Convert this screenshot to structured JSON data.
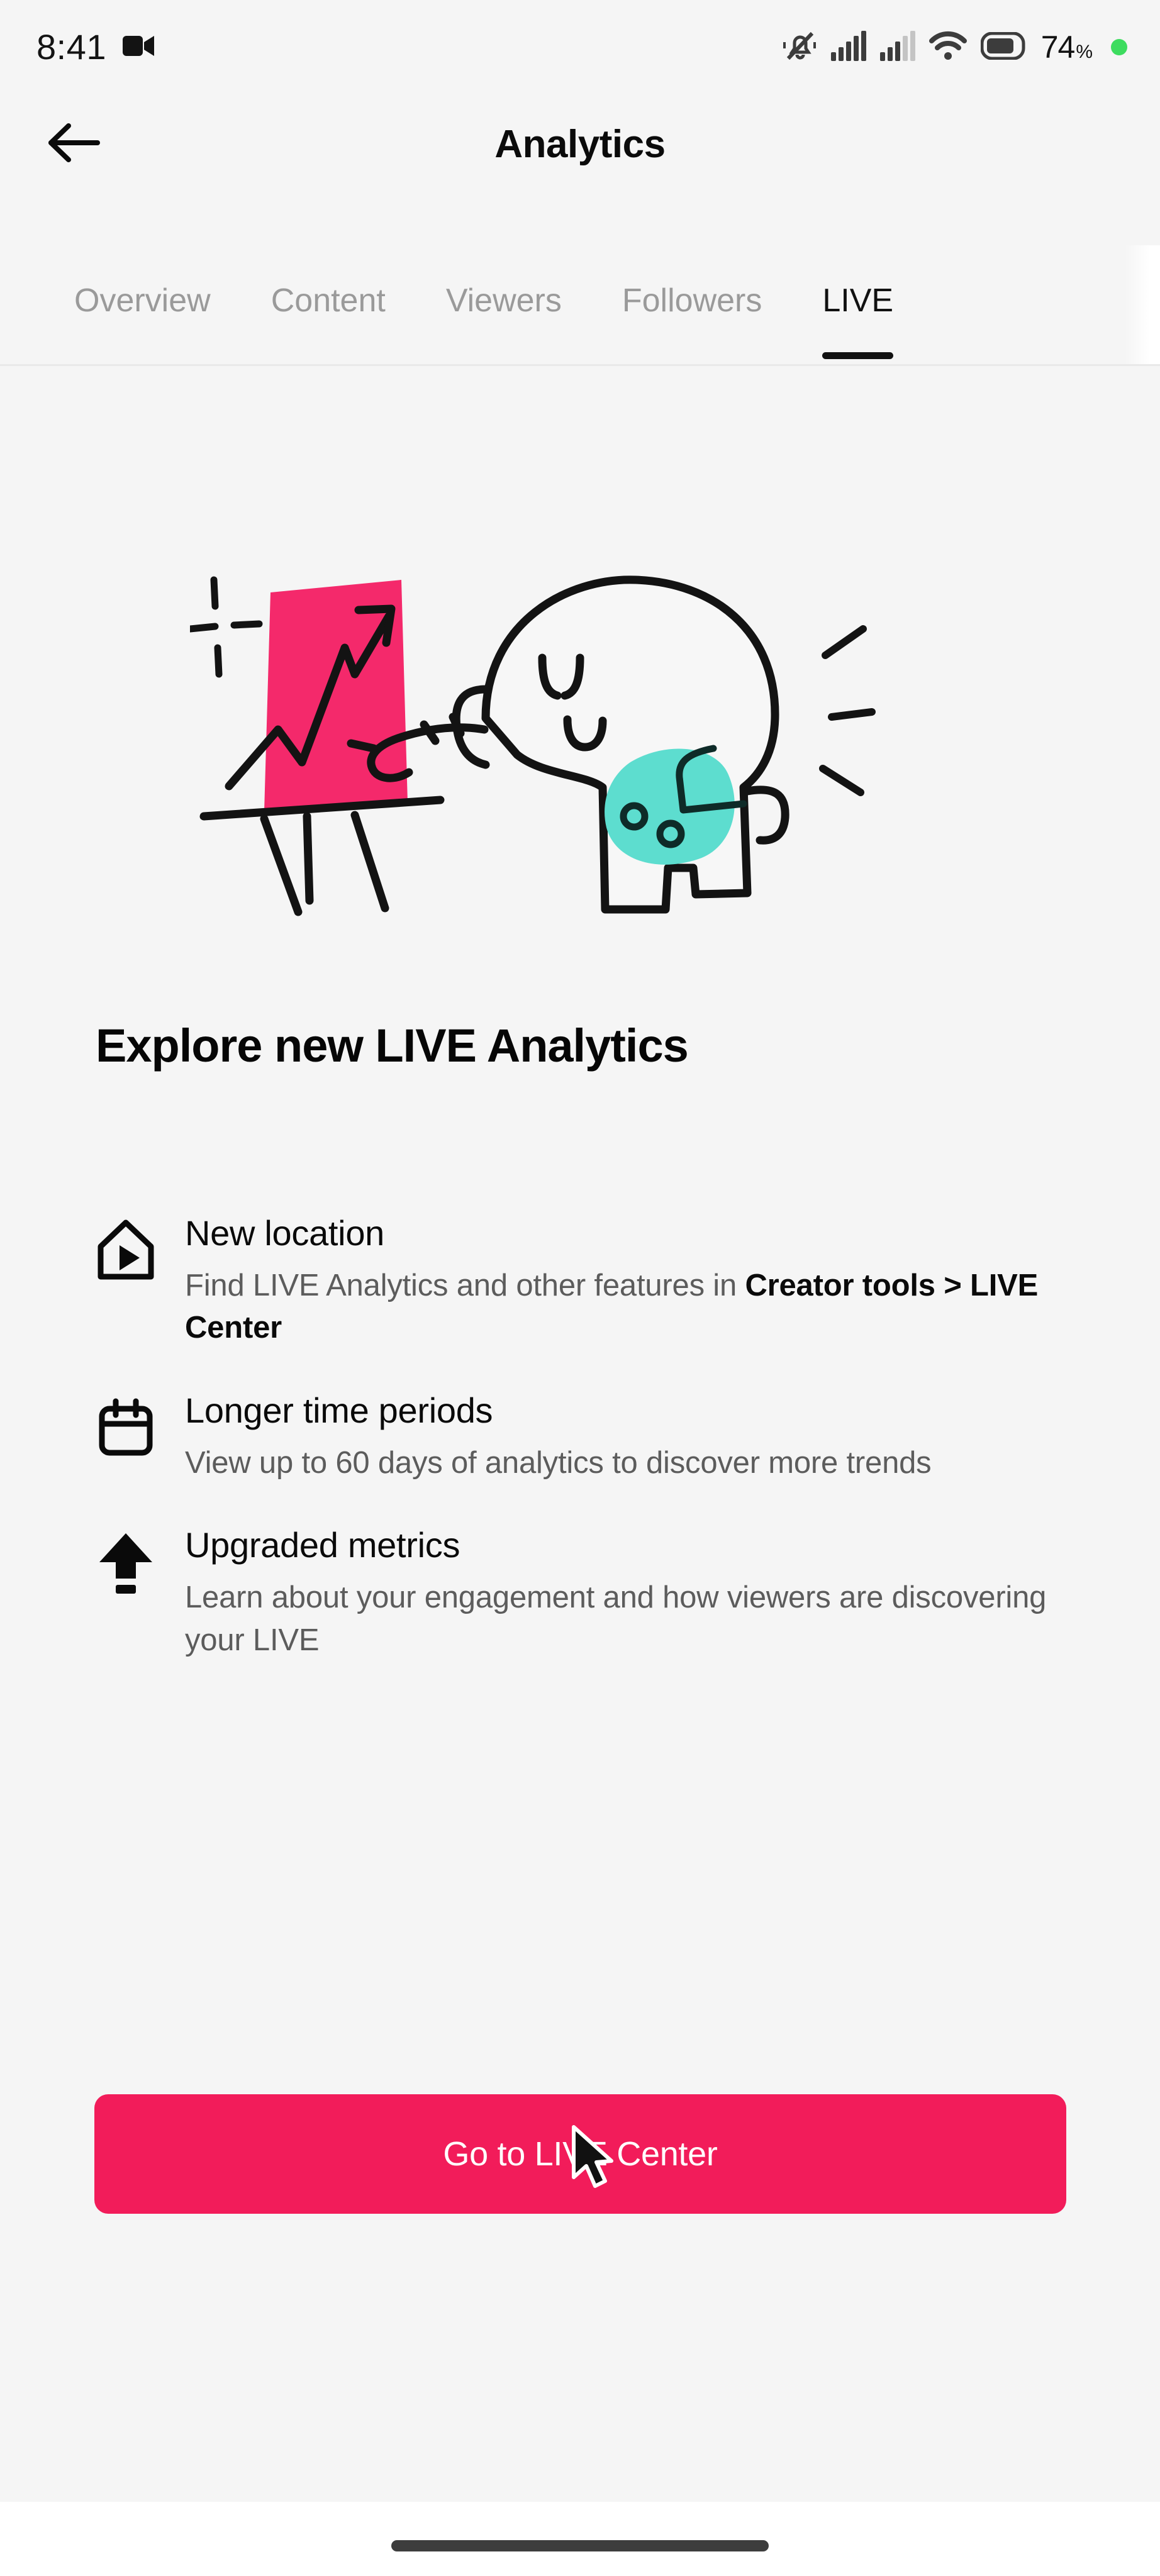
{
  "statusbar": {
    "time": "8:41",
    "battery_percent": "74",
    "percent_symbol": "%",
    "icons": [
      "video-camera-icon",
      "bell-silent-icon",
      "signal-bars-icon",
      "signal-bars-secondary-icon",
      "wifi-icon",
      "battery-icon",
      "recording-indicator-dot"
    ],
    "recording_dot_color": "#3ddc5f"
  },
  "header": {
    "title": "Analytics",
    "back_icon": "back-arrow-icon"
  },
  "tabs": [
    {
      "label": "Overview",
      "active": false
    },
    {
      "label": "Content",
      "active": false
    },
    {
      "label": "Viewers",
      "active": false
    },
    {
      "label": "Followers",
      "active": false
    },
    {
      "label": "LIVE",
      "active": true
    }
  ],
  "illustration": {
    "name": "elephant-presenting-chart-illustration",
    "board_color": "#f4296b",
    "blob_color": "#5dddcf",
    "line_color": "#131313"
  },
  "main": {
    "headline": "Explore new LIVE Analytics",
    "features": [
      {
        "icon": "live-home-play-icon",
        "title": "New location",
        "desc_plain": "Find LIVE Analytics and other features in",
        "desc_strong": "Creator tools > LIVE Center"
      },
      {
        "icon": "calendar-icon",
        "title": "Longer time periods",
        "desc_plain": "View up to 60 days of analytics to discover more trends",
        "desc_strong": ""
      },
      {
        "icon": "arrow-up-upgrade-icon",
        "title": "Upgraded metrics",
        "desc_plain": "Learn about your engagement and how viewers are discovering your LIVE",
        "desc_strong": ""
      }
    ],
    "cta_label": "Go to LIVE Center",
    "cta_color": "#f21c5a"
  },
  "bottombar": {
    "gesture_pill": "home-gesture-pill"
  }
}
